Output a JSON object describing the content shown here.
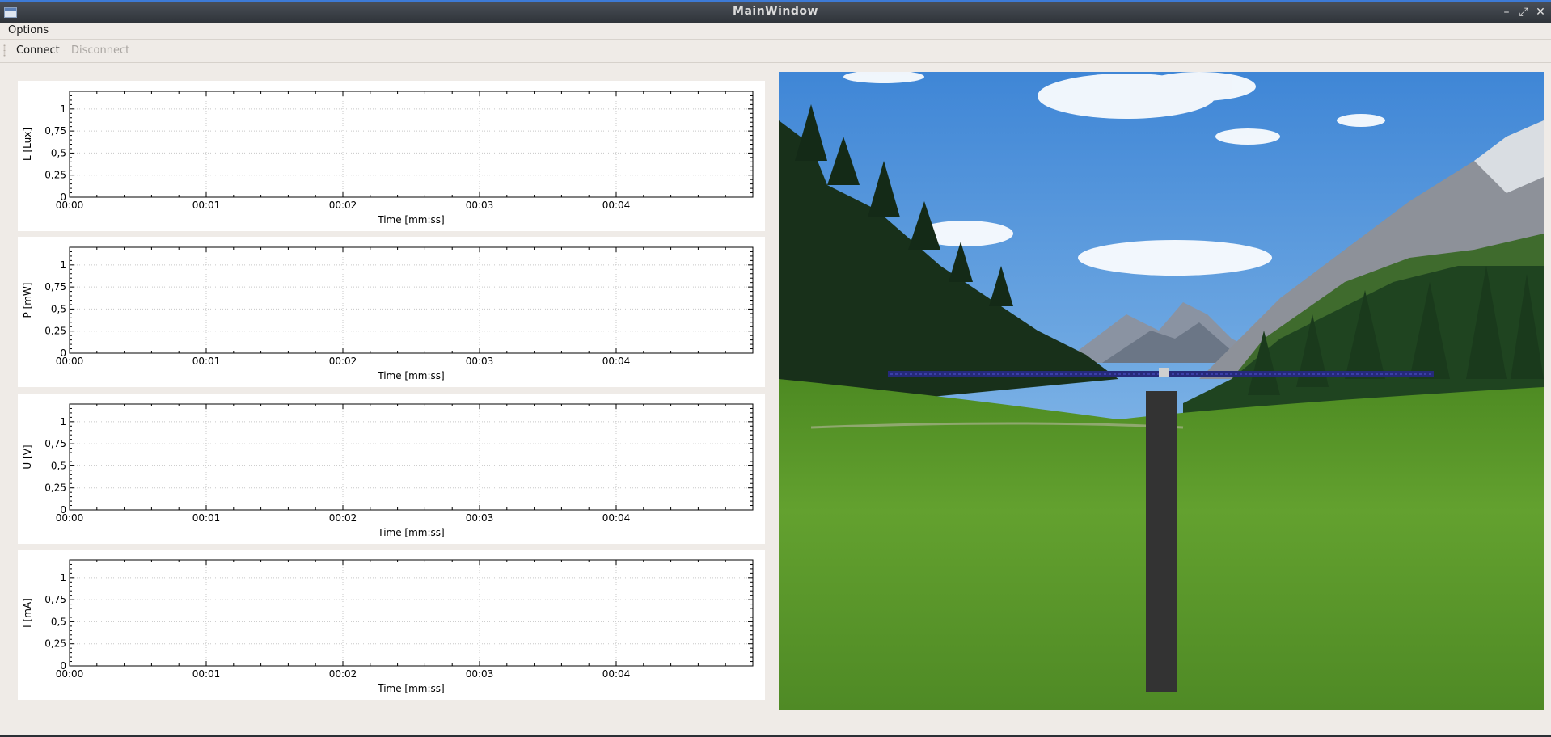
{
  "window": {
    "title": "MainWindow",
    "buttons": {
      "minimize": "–",
      "maximize": "⤢",
      "close": "✕"
    }
  },
  "menubar": {
    "options_label": "Options"
  },
  "toolbar": {
    "connect_label": "Connect",
    "disconnect_label": "Disconnect"
  },
  "plots": [
    {
      "ylabel": "L [Lux]",
      "xlabel": "Time [mm:ss]"
    },
    {
      "ylabel": "P [mW]",
      "xlabel": "Time [mm:ss]"
    },
    {
      "ylabel": "U [V]",
      "xlabel": "Time [mm:ss]"
    },
    {
      "ylabel": "I [mA]",
      "xlabel": "Time [mm:ss]"
    }
  ],
  "axis": {
    "y_ticks": [
      "0",
      "0,25",
      "0,5",
      "0,75",
      "1"
    ],
    "x_ticks": [
      "00:00",
      "00:01",
      "00:02",
      "00:03",
      "00:04"
    ]
  },
  "chart_data": [
    {
      "type": "line",
      "ylabel": "L [Lux]",
      "xlabel": "Time [mm:ss]",
      "xlim": [
        "00:00",
        "00:05"
      ],
      "ylim": [
        0,
        1.2
      ],
      "grid": true,
      "series": []
    },
    {
      "type": "line",
      "ylabel": "P [mW]",
      "xlabel": "Time [mm:ss]",
      "xlim": [
        "00:00",
        "00:05"
      ],
      "ylim": [
        0,
        1.2
      ],
      "grid": true,
      "series": []
    },
    {
      "type": "line",
      "ylabel": "U [V]",
      "xlabel": "Time [mm:ss]",
      "xlim": [
        "00:00",
        "00:05"
      ],
      "ylim": [
        0,
        1.2
      ],
      "grid": true,
      "series": []
    },
    {
      "type": "line",
      "ylabel": "I [mA]",
      "xlabel": "Time [mm:ss]",
      "xlim": [
        "00:00",
        "00:05"
      ],
      "ylim": [
        0,
        1.2
      ],
      "grid": true,
      "series": []
    }
  ],
  "scene": {
    "description_icon": "landscape-image",
    "colors": {
      "sky": "#5d97d6",
      "grass": "#5e9b2c",
      "pole": "#333333",
      "panel": "#2e2f8a"
    }
  }
}
